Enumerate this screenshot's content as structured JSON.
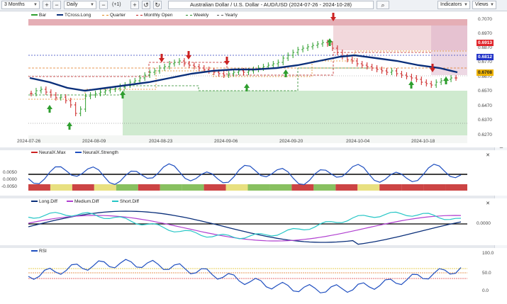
{
  "toolbar": {
    "range": "3 Months",
    "interval": "Daily",
    "plus_one": "(+1)",
    "title": "Australian Dollar / U.S. Dollar - AUD/USD (2024-07-26 - 2024-10-28)",
    "indicators_label": "Indicators",
    "views_label": "Views"
  },
  "main_chart": {
    "legend": [
      "Bar",
      "TCross.Long",
      "Quarter",
      "Monthly Open",
      "Weekly",
      "Yearly"
    ],
    "y_ticks": [
      "0.7070",
      "0.6970",
      "0.6870",
      "0.6770",
      "0.6670",
      "0.6570",
      "0.6470",
      "0.6370",
      "0.6270"
    ],
    "x_ticks": [
      "2024-07-26",
      "2024-08-09",
      "2024-08-23",
      "2024-09-06",
      "2024-09-20",
      "2024-10-04",
      "2024-10-18"
    ],
    "price_tags": [
      {
        "value": "0.6913",
        "color": "#e0242a"
      },
      {
        "value": "0.6812",
        "color": "#2233c8"
      },
      {
        "value": "0.6708",
        "color": "#f0b400"
      }
    ]
  },
  "neural_panel": {
    "legend": [
      "NeuralX.Max",
      "NeuralX.Strength"
    ],
    "y_ticks": [
      "0.0050",
      "0.0000",
      "-0.0050"
    ]
  },
  "diff_panel": {
    "legend": [
      "Long.Diff",
      "Medium.Diff",
      "Short.Diff"
    ],
    "y_ticks": [
      "0.0000"
    ]
  },
  "rsi_panel": {
    "legend": [
      "RSI"
    ],
    "y_ticks": [
      "100.0",
      "50.0",
      "0.0"
    ]
  },
  "colors": {
    "bull": "#2e9e2e",
    "bear": "#cc2222",
    "tcross": "#0a2f7a",
    "strength": "#1f4fc0",
    "medium": "#b040d0",
    "short": "#26c6c6",
    "rsi": "#1f4fc0"
  },
  "icons": [
    "search-icon",
    "zoom-in-icon",
    "zoom-out-icon",
    "crosshair-icon",
    "draw-line-icon",
    "settings-icon"
  ]
}
